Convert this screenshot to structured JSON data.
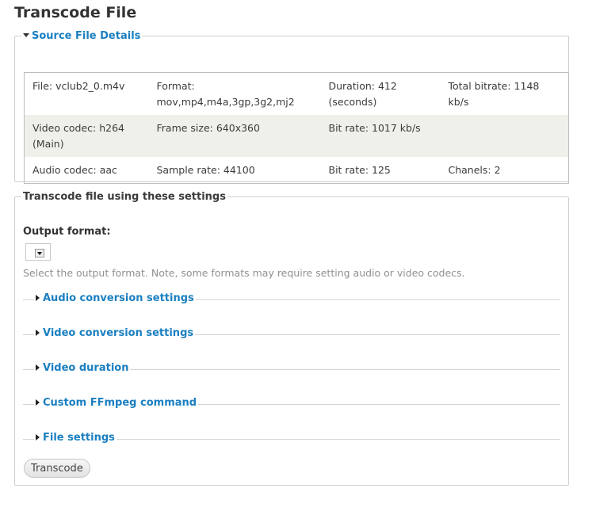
{
  "page": {
    "title": "Transcode File"
  },
  "source": {
    "legend": "Source File Details",
    "rows": [
      [
        "File: vclub2_0.m4v",
        "Format: mov,mp4,m4a,3gp,3g2,mj2",
        "Duration: 412 (seconds)",
        "Total bitrate: 1148 kb/s"
      ],
      [
        "Video codec: h264 (Main)",
        "Frame size: 640x360",
        "Bit rate: 1017 kb/s",
        ""
      ],
      [
        "Audio codec: aac",
        "Sample rate: 44100",
        "Bit rate: 125",
        "Chanels: 2"
      ]
    ]
  },
  "settings": {
    "legend": "Transcode file using these settings",
    "output_label": "Output format:",
    "output_value": "",
    "output_description": "Select the output format. Note, some formats may require setting audio or video codecs.",
    "sections": [
      "Audio conversion settings",
      "Video conversion settings",
      "Video duration",
      "Custom FFmpeg command",
      "File settings"
    ],
    "submit_label": "Transcode"
  }
}
